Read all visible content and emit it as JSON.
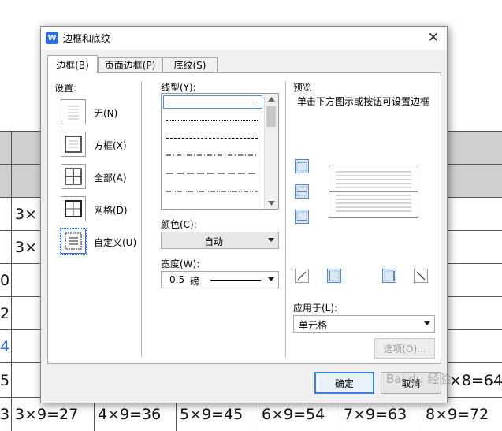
{
  "window": {
    "title": "边框和底纹",
    "app_icon_letter": "W"
  },
  "tabs": [
    {
      "label": "边框(B)",
      "active": true
    },
    {
      "label": "页面边框(P)",
      "active": false
    },
    {
      "label": "底纹(S)",
      "active": false
    }
  ],
  "settings": {
    "header": "设置:",
    "items": [
      {
        "label": "无(N)",
        "icon": "no-border-icon"
      },
      {
        "label": "方框(X)",
        "icon": "box-border-icon"
      },
      {
        "label": "全部(A)",
        "icon": "all-borders-icon"
      },
      {
        "label": "网格(D)",
        "icon": "grid-border-icon"
      },
      {
        "label": "自定义(U)",
        "icon": "custom-border-icon",
        "selected": true
      }
    ]
  },
  "line_style": {
    "label": "线型(Y):",
    "options": [
      "solid",
      "dotted",
      "dashed",
      "dash-dot",
      "long-dash",
      "dash-dot-dot"
    ],
    "selected_index": 0
  },
  "color": {
    "label": "颜色(C):",
    "value": "自动"
  },
  "width": {
    "label": "宽度(W):",
    "value_num": "0.5",
    "value_unit": "磅"
  },
  "preview": {
    "header": "预览",
    "hint": "单击下方图示或按钮可设置边框"
  },
  "apply_to": {
    "label": "应用于(L):",
    "value": "单元格"
  },
  "buttons": {
    "options": "选项(O)...",
    "ok": "确定",
    "cancel": "取消"
  },
  "background_table": {
    "visible_cells": [
      [
        "3×",
        "3×",
        "0",
        "2",
        "4",
        "5"
      ],
      [
        "3",
        "3×9=27",
        "4×9=36",
        "5×9=45",
        "6×9=54",
        "7×9=63",
        "8×9=72"
      ],
      [
        "×8=64"
      ]
    ]
  },
  "watermark": "Bai du 经验",
  "colors": {
    "accent": "#2b6ddb",
    "dialog_bg": "#f0f0f0",
    "table_gray": "#d0d0d0"
  }
}
